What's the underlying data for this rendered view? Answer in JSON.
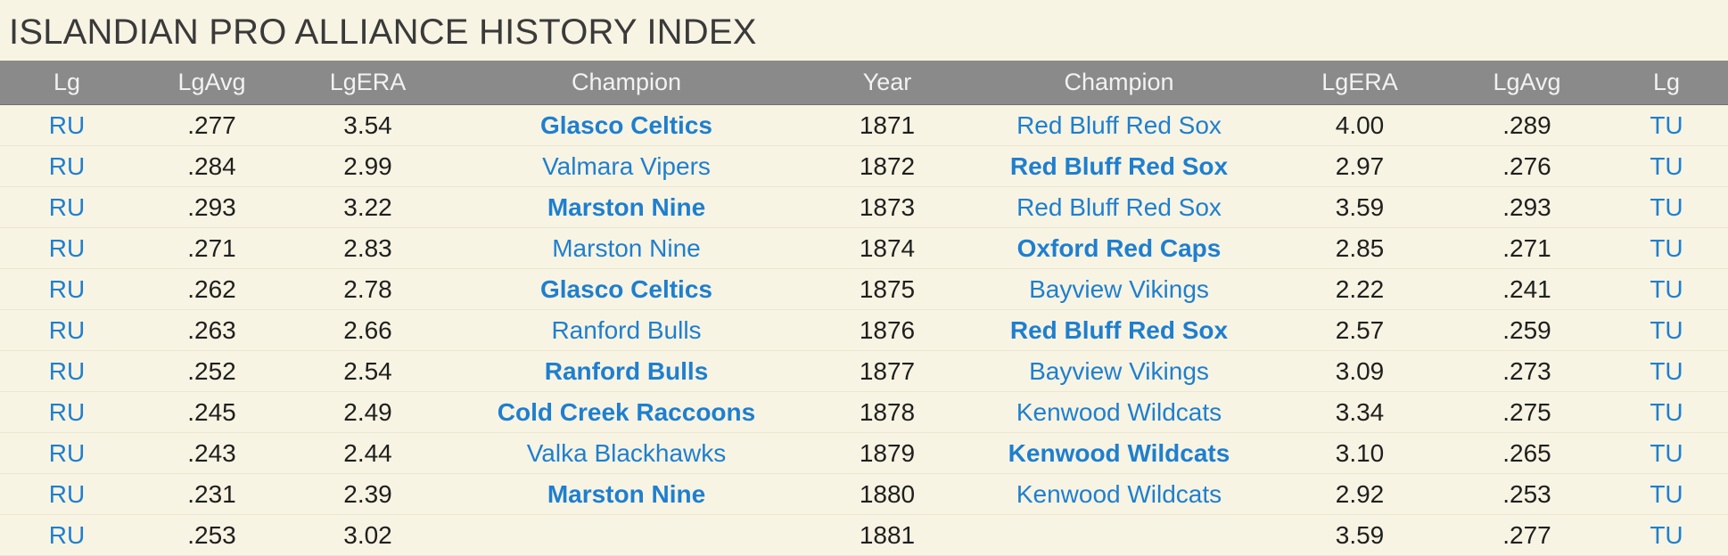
{
  "page": {
    "title": "ISLANDIAN PRO ALLIANCE HISTORY INDEX"
  },
  "colors": {
    "background": "#f8f4e3",
    "header_bg": "#8a8a8a",
    "header_text": "#f2f2f2",
    "link": "#1e7fcf",
    "text": "#1f1f1f"
  },
  "table": {
    "headers": [
      "Lg",
      "LgAvg",
      "LgERA",
      "Champion",
      "Year",
      "Champion",
      "LgERA",
      "LgAvg",
      "Lg"
    ],
    "rows": [
      {
        "lg_left": "RU",
        "avg_left": ".277",
        "era_left": "3.54",
        "champ_left": "Glasco Celtics",
        "champ_left_bold": true,
        "year": "1871",
        "champ_right": "Red Bluff Red Sox",
        "champ_right_bold": false,
        "era_right": "4.00",
        "avg_right": ".289",
        "lg_right": "TU"
      },
      {
        "lg_left": "RU",
        "avg_left": ".284",
        "era_left": "2.99",
        "champ_left": "Valmara Vipers",
        "champ_left_bold": false,
        "year": "1872",
        "champ_right": "Red Bluff Red Sox",
        "champ_right_bold": true,
        "era_right": "2.97",
        "avg_right": ".276",
        "lg_right": "TU"
      },
      {
        "lg_left": "RU",
        "avg_left": ".293",
        "era_left": "3.22",
        "champ_left": "Marston Nine",
        "champ_left_bold": true,
        "year": "1873",
        "champ_right": "Red Bluff Red Sox",
        "champ_right_bold": false,
        "era_right": "3.59",
        "avg_right": ".293",
        "lg_right": "TU"
      },
      {
        "lg_left": "RU",
        "avg_left": ".271",
        "era_left": "2.83",
        "champ_left": "Marston Nine",
        "champ_left_bold": false,
        "year": "1874",
        "champ_right": "Oxford Red Caps",
        "champ_right_bold": true,
        "era_right": "2.85",
        "avg_right": ".271",
        "lg_right": "TU"
      },
      {
        "lg_left": "RU",
        "avg_left": ".262",
        "era_left": "2.78",
        "champ_left": "Glasco Celtics",
        "champ_left_bold": true,
        "year": "1875",
        "champ_right": "Bayview Vikings",
        "champ_right_bold": false,
        "era_right": "2.22",
        "avg_right": ".241",
        "lg_right": "TU"
      },
      {
        "lg_left": "RU",
        "avg_left": ".263",
        "era_left": "2.66",
        "champ_left": "Ranford Bulls",
        "champ_left_bold": false,
        "year": "1876",
        "champ_right": "Red Bluff Red Sox",
        "champ_right_bold": true,
        "era_right": "2.57",
        "avg_right": ".259",
        "lg_right": "TU"
      },
      {
        "lg_left": "RU",
        "avg_left": ".252",
        "era_left": "2.54",
        "champ_left": "Ranford Bulls",
        "champ_left_bold": true,
        "year": "1877",
        "champ_right": "Bayview Vikings",
        "champ_right_bold": false,
        "era_right": "3.09",
        "avg_right": ".273",
        "lg_right": "TU"
      },
      {
        "lg_left": "RU",
        "avg_left": ".245",
        "era_left": "2.49",
        "champ_left": "Cold Creek Raccoons",
        "champ_left_bold": true,
        "year": "1878",
        "champ_right": "Kenwood Wildcats",
        "champ_right_bold": false,
        "era_right": "3.34",
        "avg_right": ".275",
        "lg_right": "TU"
      },
      {
        "lg_left": "RU",
        "avg_left": ".243",
        "era_left": "2.44",
        "champ_left": "Valka Blackhawks",
        "champ_left_bold": false,
        "year": "1879",
        "champ_right": "Kenwood Wildcats",
        "champ_right_bold": true,
        "era_right": "3.10",
        "avg_right": ".265",
        "lg_right": "TU"
      },
      {
        "lg_left": "RU",
        "avg_left": ".231",
        "era_left": "2.39",
        "champ_left": "Marston Nine",
        "champ_left_bold": true,
        "year": "1880",
        "champ_right": "Kenwood Wildcats",
        "champ_right_bold": false,
        "era_right": "2.92",
        "avg_right": ".253",
        "lg_right": "TU"
      },
      {
        "lg_left": "RU",
        "avg_left": ".253",
        "era_left": "3.02",
        "champ_left": "",
        "champ_left_bold": false,
        "year": "1881",
        "champ_right": "",
        "champ_right_bold": false,
        "era_right": "3.59",
        "avg_right": ".277",
        "lg_right": "TU"
      }
    ]
  }
}
